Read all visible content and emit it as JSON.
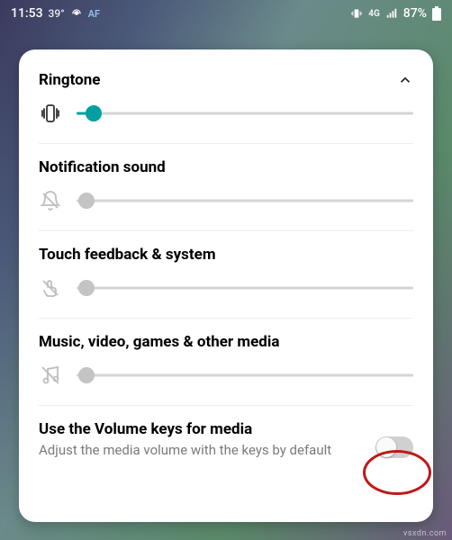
{
  "statusbar": {
    "time": "11:53",
    "temp": "39°",
    "network": "4G",
    "battery_pct": "87%"
  },
  "card": {
    "ringtone": {
      "title": "Ringtone",
      "value_pct": 5
    },
    "notification": {
      "title": "Notification sound",
      "value_pct": 3
    },
    "touch": {
      "title": "Touch feedback & system",
      "value_pct": 3
    },
    "media": {
      "title": "Music, video, games & other media",
      "value_pct": 3
    },
    "volumekeys": {
      "title": "Use the Volume keys for media",
      "desc": "Adjust the media volume with the keys by default",
      "enabled": false
    }
  },
  "watermark": "vsxdn.com"
}
